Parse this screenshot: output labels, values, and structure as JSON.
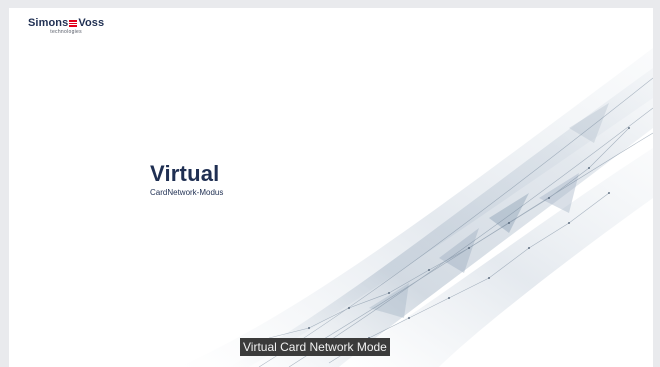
{
  "brand": {
    "name_left": "Simons",
    "name_right": "Voss",
    "tagline": "technologies",
    "accent_color": "#e3001b",
    "text_color": "#1f2f52"
  },
  "hero": {
    "title": "Virtual",
    "subtitle": "CardNetwork-Modus"
  },
  "caption": {
    "text": "Virtual Card Network Mode"
  },
  "decoration": {
    "icon": "network-mesh-graphic"
  }
}
